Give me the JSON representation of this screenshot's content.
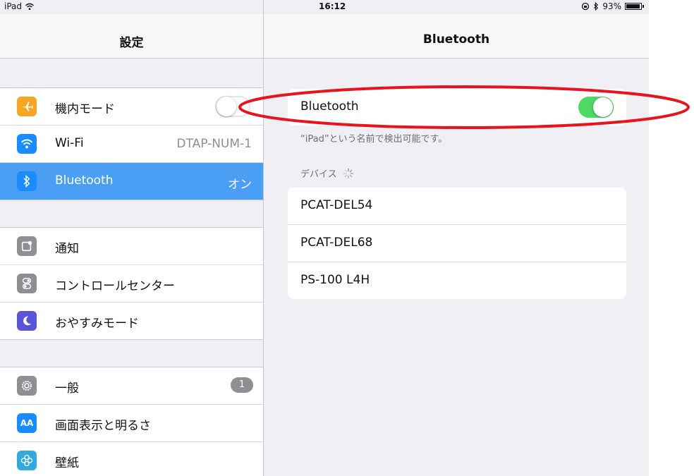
{
  "status_bar": {
    "device": "iPad",
    "time": "16:12",
    "battery": "93%"
  },
  "sidebar": {
    "title": "設定",
    "groups": [
      [
        {
          "label": "機内モード",
          "icon": "airplane-icon",
          "color": "#f5a623",
          "toggle": "off"
        },
        {
          "label": "Wi-Fi",
          "icon": "wifi-icon",
          "color": "#1a8cff",
          "value": "DTAP-NUM-1"
        },
        {
          "label": "Bluetooth",
          "icon": "bluetooth-icon",
          "color": "#1a8cff",
          "value": "オン",
          "selected": true
        }
      ],
      [
        {
          "label": "通知",
          "icon": "notification-icon",
          "color": "#8e8e93"
        },
        {
          "label": "コントロールセンター",
          "icon": "control-center-icon",
          "color": "#8e8e93"
        },
        {
          "label": "おやすみモード",
          "icon": "moon-icon",
          "color": "#5856d6"
        }
      ],
      [
        {
          "label": "一般",
          "icon": "gear-icon",
          "color": "#8e8e93",
          "badge": "1"
        },
        {
          "label": "画面表示と明るさ",
          "icon": "display-icon",
          "color": "#1a8cff"
        },
        {
          "label": "壁紙",
          "icon": "wallpaper-icon",
          "color": "#34aadc"
        }
      ]
    ]
  },
  "detail": {
    "title": "Bluetooth",
    "bluetooth_label": "Bluetooth",
    "bluetooth_state": "on",
    "discoverable_note": "“iPad”という名前で検出可能です。",
    "devices_label": "デバイス",
    "devices": [
      "PCAT-DEL54",
      "PCAT-DEL68",
      "PS-100 L4H"
    ]
  },
  "colors": {
    "accent": "#4a9ff5",
    "toggle_on": "#4cd964",
    "annotation": "#e8131c"
  }
}
